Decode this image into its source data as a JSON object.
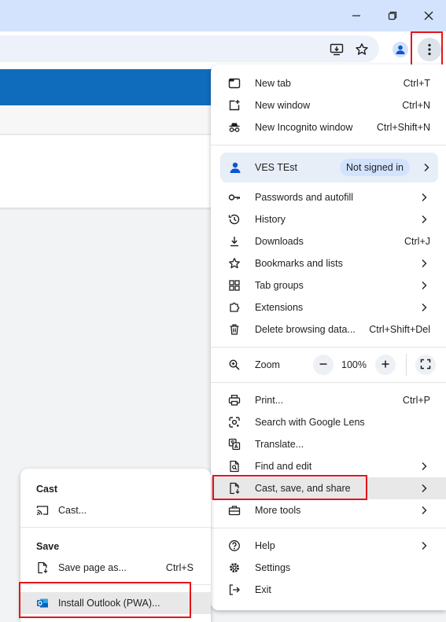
{
  "window": {
    "controls": [
      {
        "name": "minimize-icon"
      },
      {
        "name": "restore-icon"
      },
      {
        "name": "close-icon"
      }
    ]
  },
  "toolbar": {
    "icons": [
      "install-app-icon",
      "bookmark-star-icon",
      "profile-avatar-icon",
      "more-menu-icon"
    ]
  },
  "menu": {
    "items_top": [
      {
        "icon": "new-tab-icon",
        "label": "New tab",
        "shortcut": "Ctrl+T"
      },
      {
        "icon": "new-window-icon",
        "label": "New window",
        "shortcut": "Ctrl+N"
      },
      {
        "icon": "incognito-icon",
        "label": "New Incognito window",
        "shortcut": "Ctrl+Shift+N"
      }
    ],
    "profile": {
      "name": "VES TEst",
      "status": "Not signed in"
    },
    "items_mid": [
      {
        "icon": "key-icon",
        "label": "Passwords and autofill",
        "shortcut": ""
      },
      {
        "icon": "history-icon",
        "label": "History",
        "shortcut": ""
      },
      {
        "icon": "download-icon",
        "label": "Downloads",
        "shortcut": "Ctrl+J"
      },
      {
        "icon": "star-icon",
        "label": "Bookmarks and lists",
        "shortcut": ""
      },
      {
        "icon": "tab-groups-icon",
        "label": "Tab groups",
        "shortcut": ""
      },
      {
        "icon": "extensions-icon",
        "label": "Extensions",
        "shortcut": ""
      },
      {
        "icon": "trash-icon",
        "label": "Delete browsing data...",
        "shortcut": "Ctrl+Shift+Del"
      }
    ],
    "zoom": {
      "label": "Zoom",
      "value": "100%",
      "minus": "−",
      "plus": "+"
    },
    "items_tools": [
      {
        "icon": "print-icon",
        "label": "Print...",
        "shortcut": "Ctrl+P"
      },
      {
        "icon": "lens-icon",
        "label": "Search with Google Lens",
        "shortcut": ""
      },
      {
        "icon": "translate-icon",
        "label": "Translate...",
        "shortcut": ""
      },
      {
        "icon": "find-icon",
        "label": "Find and edit",
        "shortcut": ""
      },
      {
        "icon": "cast-save-share-icon",
        "label": "Cast, save, and share",
        "shortcut": ""
      },
      {
        "icon": "toolbox-icon",
        "label": "More tools",
        "shortcut": ""
      }
    ],
    "items_bottom": [
      {
        "icon": "help-icon",
        "label": "Help",
        "shortcut": ""
      },
      {
        "icon": "settings-gear-icon",
        "label": "Settings",
        "shortcut": ""
      },
      {
        "icon": "exit-icon",
        "label": "Exit",
        "shortcut": ""
      }
    ]
  },
  "submenu": {
    "cast_heading": "Cast",
    "cast_item": "Cast...",
    "save_heading": "Save",
    "save_item": "Save page as...",
    "save_shortcut": "Ctrl+S",
    "install_item": "Install Outlook (PWA)..."
  },
  "colors": {
    "accent": "#0b57d0",
    "highlight_box": "#e4141b",
    "page_band": "#0f6cbd",
    "titlebar": "#d3e3fd"
  }
}
